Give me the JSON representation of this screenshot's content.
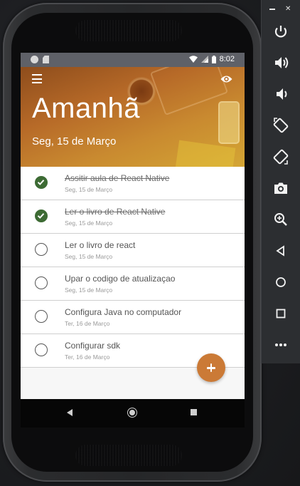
{
  "statusbar": {
    "time": "8:02"
  },
  "header": {
    "title": "Amanhã",
    "subtitle": "Seg, 15 de Março",
    "menu_icon": "hamburger-menu-icon",
    "eye_icon": "eye-icon"
  },
  "tasks": [
    {
      "title": "Assitir aula de React Native",
      "date": "Seg, 15 de Março",
      "done": true
    },
    {
      "title": "Ler o livro de React Native",
      "date": "Seg, 15 de Março",
      "done": true
    },
    {
      "title": "Ler o livro de react",
      "date": "Seg, 15 de Março",
      "done": false
    },
    {
      "title": "Upar o codigo de atualizaçao",
      "date": "Seg, 15 de Março",
      "done": false
    },
    {
      "title": "Configura Java no computador",
      "date": "Ter, 16 de Março",
      "done": false
    },
    {
      "title": "Configurar sdk",
      "date": "Ter, 16 de Março",
      "done": false
    }
  ],
  "fab": {
    "icon": "plus-icon"
  },
  "navbar": {
    "back_icon": "back-triangle-icon",
    "home_icon": "home-circle-icon",
    "recent_icon": "recent-apps-square-icon"
  },
  "emulator_toolbar": {
    "buttons": [
      "power-icon",
      "volume-up-icon",
      "volume-down-icon",
      "rotate-left-icon",
      "rotate-right-icon",
      "camera-icon",
      "zoom-icon",
      "back-icon",
      "home-icon",
      "overview-icon",
      "more-icon"
    ]
  },
  "colors": {
    "accent": "#cb7a36",
    "check_done": "#3d6b34",
    "statusbar": "#5f6168"
  }
}
